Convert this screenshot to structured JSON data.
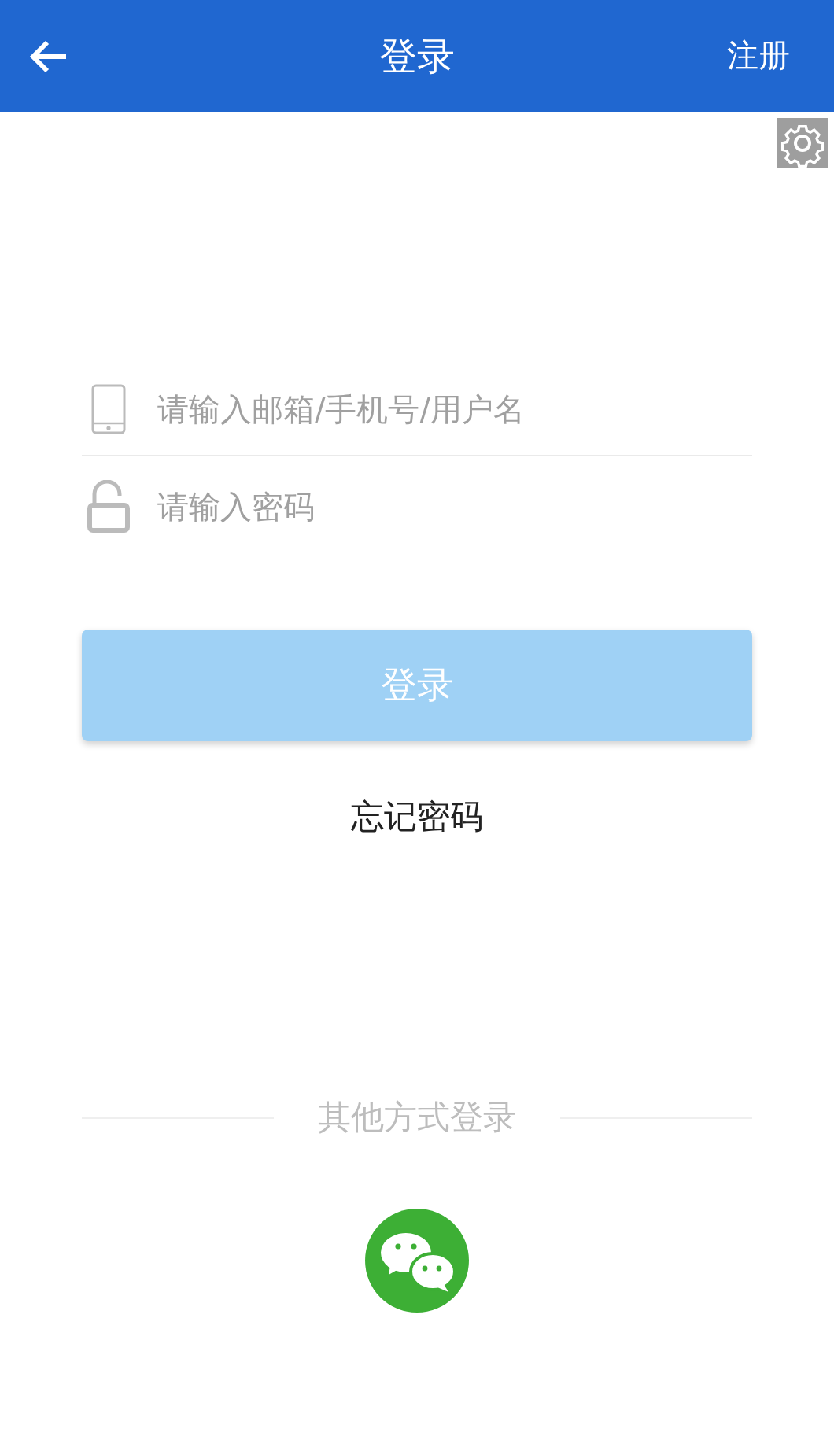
{
  "header": {
    "title": "登录",
    "action": "注册"
  },
  "fields": [
    {
      "kind": "account",
      "placeholder": "请输入邮箱/手机号/用户名"
    },
    {
      "kind": "password",
      "placeholder": "请输入密码"
    }
  ],
  "login_button": {
    "label": "登录",
    "disabled": true
  },
  "forgot_link": "忘记密码",
  "other_login": {
    "label": "其他方式登录"
  }
}
